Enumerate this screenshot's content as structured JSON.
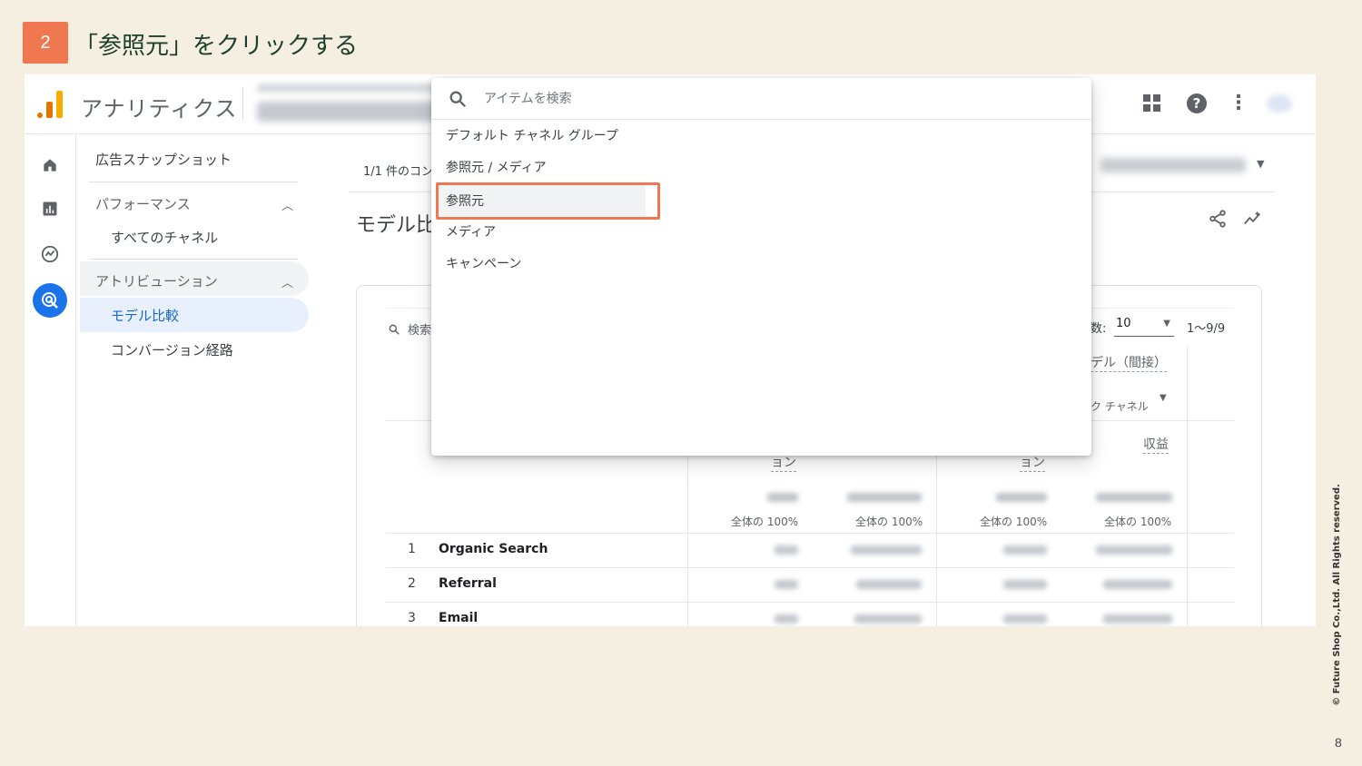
{
  "slide": {
    "step_number": "2",
    "step_title": "「参照元」をクリックする",
    "copyright": "© Future Shop Co.,Ltd. All Rights reserved.",
    "page_number": "8"
  },
  "colors": {
    "slide_background": "#f5efe1",
    "step_badge": "#f07850",
    "highlight_border": "#f07850",
    "accent_blue": "#1a73e8",
    "active_nav_bg": "#e8f0fe"
  },
  "header": {
    "app_name": "アナリティクス",
    "icons": [
      "apps-grid-icon",
      "help-icon",
      "more-vert-icon"
    ]
  },
  "rail": {
    "icons": [
      "home-icon",
      "reports-icon",
      "explore-icon",
      "advertising-icon"
    ]
  },
  "nav": {
    "snapshot": "広告スナップショット",
    "performance": "パフォーマンス",
    "all_channels": "すべてのチャネル",
    "attribution": "アトリビューション",
    "model_comparison": "モデル比較",
    "conversion_paths": "コンバージョン経路"
  },
  "main": {
    "conversion_count": "1/1 件のコン",
    "page_title": "モデル比",
    "search_placeholder": "検索",
    "rows_label": "数:",
    "rows_value": "10",
    "range": "1〜9/9",
    "model_header": "デル（間接）",
    "group_header": "ク チャネル",
    "revenue_header": "収益",
    "conversion_header_1": "ョン",
    "conversion_header_2": "ョン",
    "totals": [
      "全体の 100%",
      "全体の 100%",
      "全体の 100%",
      "全体の 100%"
    ],
    "rows": [
      {
        "index": "1",
        "name": "Organic Search"
      },
      {
        "index": "2",
        "name": "Referral"
      },
      {
        "index": "3",
        "name": "Email"
      }
    ]
  },
  "dropdown": {
    "search_placeholder": "アイテムを検索",
    "items": [
      "デフォルト チャネル グループ",
      "参照元 / メディア",
      "参照元",
      "メディア",
      "キャンペーン"
    ],
    "selected_index": 2
  }
}
